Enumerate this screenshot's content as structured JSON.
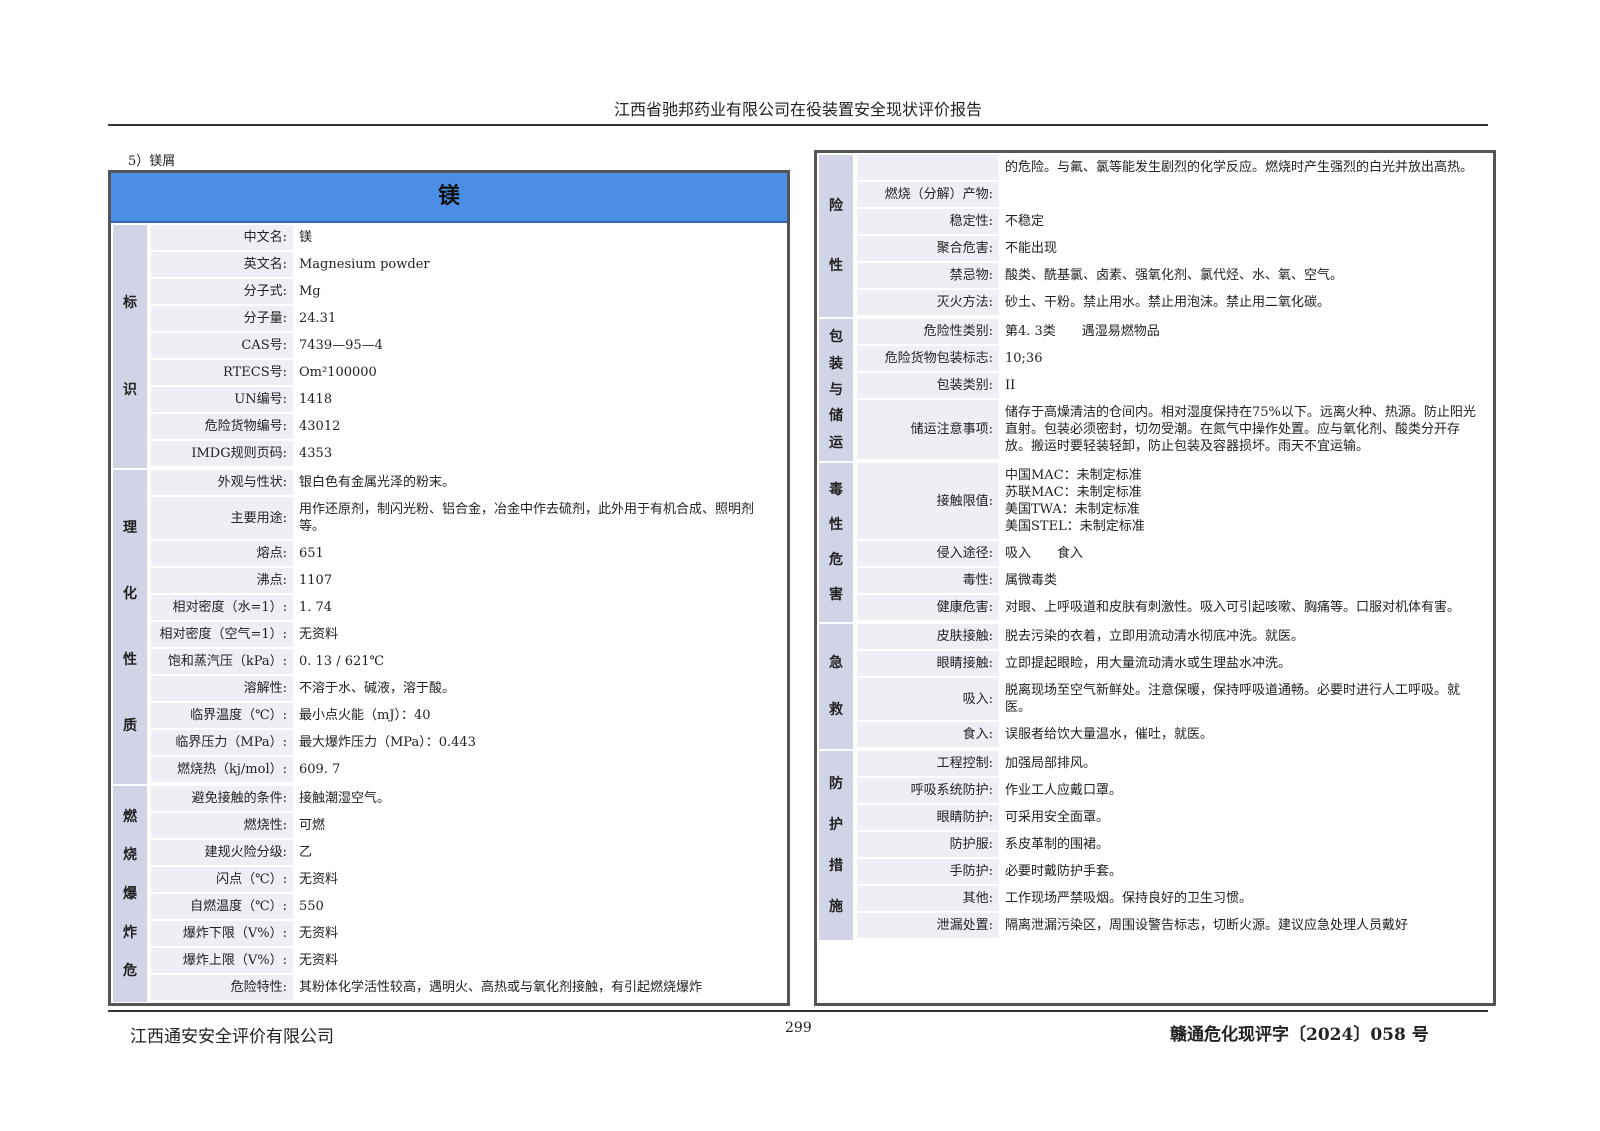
{
  "header": {
    "title": "江西省驰邦药业有限公司在役装置安全现状评价报告"
  },
  "caption": "5）镁屑",
  "left": {
    "title": "镁",
    "sections": [
      {
        "label": "标识",
        "rows": [
          {
            "label": "中文名:",
            "value": "镁"
          },
          {
            "label": "英文名:",
            "value": "Magnesium powder"
          },
          {
            "label": "分子式:",
            "value": "Mg"
          },
          {
            "label": "分子量:",
            "value": "24.31"
          },
          {
            "label": "CAS号:",
            "value": "7439—95—4"
          },
          {
            "label": "RTECS号:",
            "value": "Om²100000"
          },
          {
            "label": "UN编号:",
            "value": "1418"
          },
          {
            "label": "危险货物编号:",
            "value": "43012"
          },
          {
            "label": "IMDG规则页码:",
            "value": "4353"
          }
        ]
      },
      {
        "label": "理化性质",
        "rows": [
          {
            "label": "外观与性状:",
            "value": "银白色有金属光泽的粉末。"
          },
          {
            "label": "主要用途:",
            "value": "用作还原剂，制闪光粉、铝合金，冶金中作去硫剂，此外用于有机合成、照明剂等。"
          },
          {
            "label": "熔点:",
            "value": "651"
          },
          {
            "label": "沸点:",
            "value": "1107"
          },
          {
            "label": "相对密度（水=1）:",
            "value": "1. 74"
          },
          {
            "label": "相对密度（空气=1）:",
            "value": "无资料"
          },
          {
            "label": "饱和蒸汽压（kPa）:",
            "value": "0. 13 / 621℃"
          },
          {
            "label": "溶解性:",
            "value": "不溶于水、碱液，溶于酸。"
          },
          {
            "label": "临界温度（℃）:",
            "value": "最小点火能（mJ）：40"
          },
          {
            "label": "临界压力（MPa）:",
            "value": "最大爆炸压力（MPa）：0.443"
          },
          {
            "label": "燃烧热（kj/mol）:",
            "value": "609. 7"
          }
        ]
      },
      {
        "label": "燃烧爆炸危",
        "rows": [
          {
            "label": "避免接触的条件:",
            "value": "接触潮湿空气。"
          },
          {
            "label": "燃烧性:",
            "value": "可燃"
          },
          {
            "label": "建规火险分级:",
            "value": "乙"
          },
          {
            "label": "闪点（℃）:",
            "value": "无资料"
          },
          {
            "label": "自燃温度（℃）:",
            "value": "550"
          },
          {
            "label": "爆炸下限（V%）:",
            "value": "无资料"
          },
          {
            "label": "爆炸上限（V%）:",
            "value": "无资料"
          },
          {
            "label": "危险特性:",
            "value": "其粉体化学活性较高，遇明火、高热或与氧化剂接触，有引起燃烧爆炸"
          }
        ]
      }
    ]
  },
  "right": {
    "sections": [
      {
        "label": "险性",
        "rows": [
          {
            "label": "",
            "value": "的危险。与氟、氯等能发生剧烈的化学反应。燃烧时产生强烈的白光并放出高热。"
          },
          {
            "label": "燃烧（分解）产物:",
            "value": ""
          },
          {
            "label": "稳定性:",
            "value": "不稳定"
          },
          {
            "label": "聚合危害:",
            "value": "不能出现"
          },
          {
            "label": "禁忌物:",
            "value": "酸类、酰基氯、卤素、强氧化剂、氯代烃、水、氧、空气。"
          },
          {
            "label": "灭火方法:",
            "value": "砂土、干粉。禁止用水。禁止用泡沫。禁止用二氧化碳。"
          }
        ]
      },
      {
        "label": "包装与储运",
        "rows": [
          {
            "label": "危险性类别:",
            "value": "第4. 3类　　遇湿易燃物品"
          },
          {
            "label": "危险货物包装标志:",
            "value": "10;36"
          },
          {
            "label": "包装类别:",
            "value": "II"
          },
          {
            "label": "储运注意事项:",
            "value": "储存于高燥清洁的仓间内。相对湿度保持在75%以下。远离火种、热源。防止阳光直射。包装必须密封，切勿受潮。在氮气中操作处置。应与氧化剂、酸类分开存放。搬运时要轻装轻卸，防止包装及容器损坏。雨天不宜运输。"
          }
        ]
      },
      {
        "label": "毒性危害",
        "rows": [
          {
            "label": "接触限值:",
            "value": "中国MAC：未制定标准\n苏联MAC：未制定标准\n美国TWA：未制定标准\n美国STEL：未制定标准"
          },
          {
            "label": "侵入途径:",
            "value": "吸入　　食入"
          },
          {
            "label": "毒性:",
            "value": "属微毒类"
          },
          {
            "label": "健康危害:",
            "value": "对眼、上呼吸道和皮肤有刺激性。吸入可引起咳嗽、胸痛等。口服对机体有害。"
          }
        ]
      },
      {
        "label": "急救",
        "rows": [
          {
            "label": "皮肤接触:",
            "value": "脱去污染的衣着，立即用流动清水彻底冲洗。就医。"
          },
          {
            "label": "眼睛接触:",
            "value": "立即提起眼睑，用大量流动清水或生理盐水冲洗。"
          },
          {
            "label": "吸入:",
            "value": "脱离现场至空气新鲜处。注意保暖，保持呼吸道通畅。必要时进行人工呼吸。就医。"
          },
          {
            "label": "食入:",
            "value": "误服者给饮大量温水，催吐，就医。"
          }
        ]
      },
      {
        "label": "防护措施",
        "rows": [
          {
            "label": "工程控制:",
            "value": "加强局部排风。"
          },
          {
            "label": "呼吸系统防护:",
            "value": "作业工人应戴口罩。"
          },
          {
            "label": "眼睛防护:",
            "value": "可采用安全面罩。"
          },
          {
            "label": "防护服:",
            "value": "系皮革制的围裙。"
          },
          {
            "label": "手防护:",
            "value": "必要时戴防护手套。"
          },
          {
            "label": "其他:",
            "value": "工作现场严禁吸烟。保持良好的卫生习惯。"
          },
          {
            "label": "泄漏处置:",
            "value": "隔离泄漏污染区，周围设警告标志，切断火源。建议应急处理人员戴好"
          }
        ]
      }
    ]
  },
  "footer": {
    "company": "江西通安安全评价有限公司",
    "page": "299",
    "doc_no": "赣通危化现评字〔2024〕058 号"
  }
}
